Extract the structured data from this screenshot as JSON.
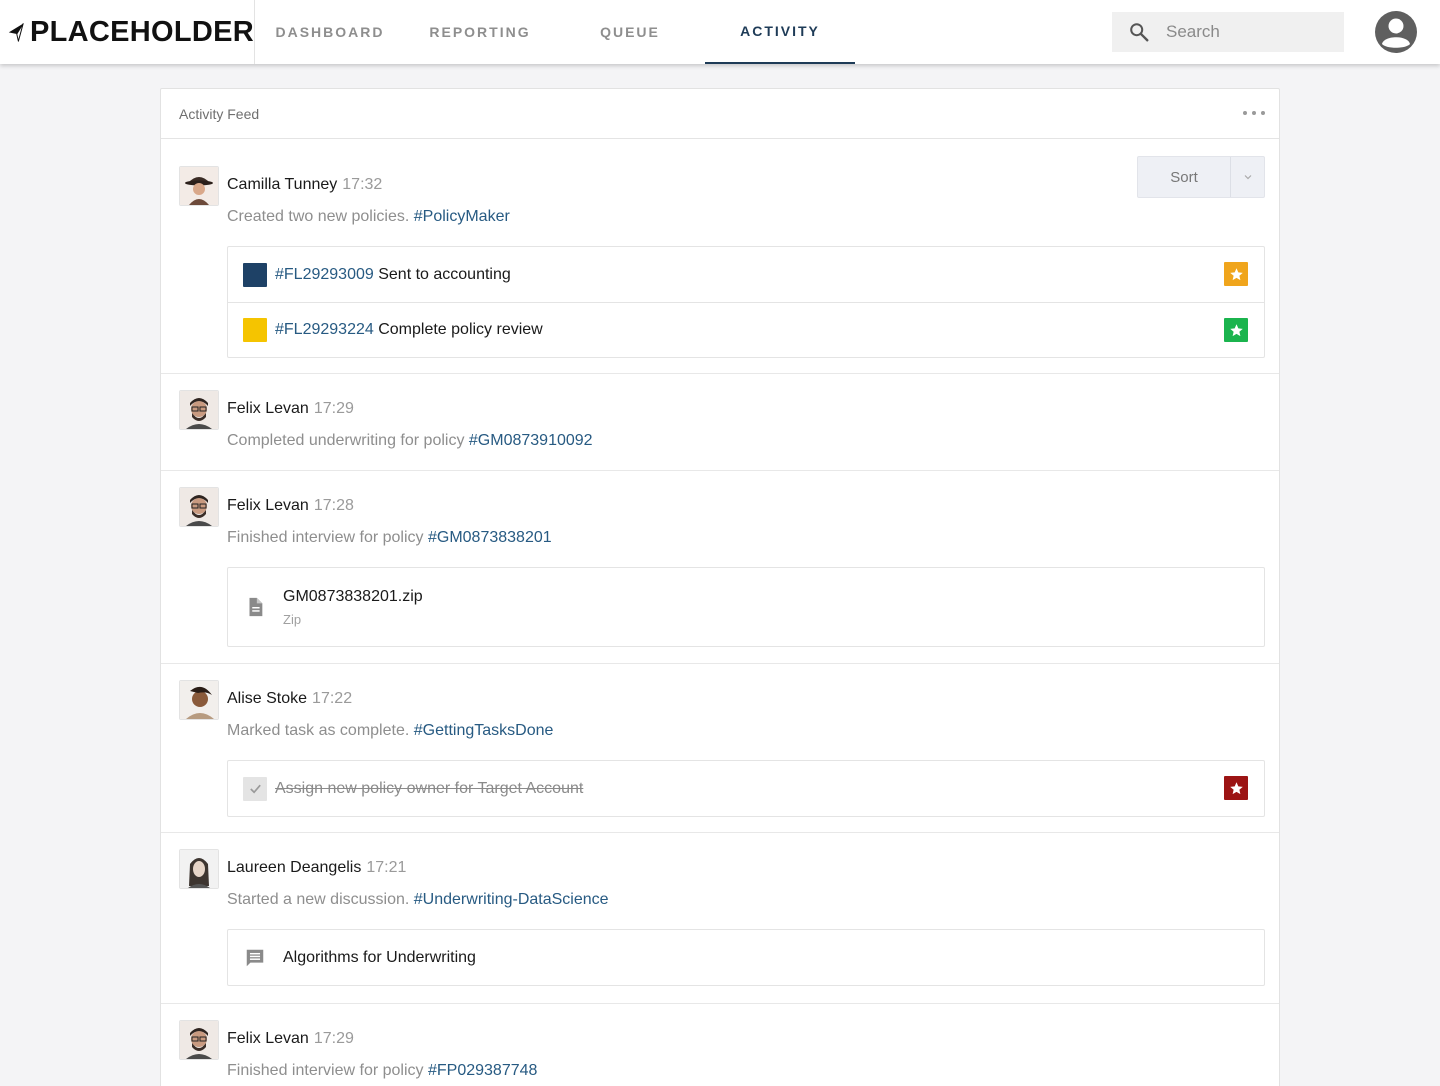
{
  "header": {
    "logo_text": "PLACEHOLDER",
    "tabs": [
      {
        "label": "DASHBOARD"
      },
      {
        "label": "REPORTING"
      },
      {
        "label": "QUEUE"
      },
      {
        "label": "ACTIVITY",
        "active": true
      }
    ],
    "search_placeholder": "Search"
  },
  "feed": {
    "title": "Activity Feed",
    "sort_label": "Sort",
    "entries": [
      {
        "name": "Camilla Tunney",
        "time": "17:32",
        "text": "Created two new policies.",
        "tag": "#PolicyMaker",
        "items": [
          {
            "id": "#FL29293009",
            "label": "Sent to accounting",
            "swatch": "#1e4166",
            "star_color": "#f0a51c"
          },
          {
            "id": "#FL29293224",
            "label": "Complete policy review",
            "swatch": "#f5c400",
            "star_color": "#1bb44e"
          }
        ]
      },
      {
        "name": "Felix Levan",
        "time": "17:29",
        "text": "Completed underwriting for policy",
        "tag": "#GM0873910092"
      },
      {
        "name": "Felix Levan",
        "time": "17:28",
        "text": "Finished interview for policy",
        "tag": "#GM0873838201",
        "file": {
          "name": "GM0873838201.zip",
          "type": "Zip",
          "icon": "document-icon"
        }
      },
      {
        "name": "Alise Stoke",
        "time": "17:22",
        "text": "Marked task as complete.",
        "tag": "#GettingTasksDone",
        "task": {
          "label": "Assign new policy owner for Target Account",
          "star_color": "#9c1414"
        }
      },
      {
        "name": "Laureen Deangelis",
        "time": "17:21",
        "text": "Started a new discussion.",
        "tag": "#Underwriting-DataScience",
        "discussion": {
          "label": "Algorithms for Underwriting",
          "icon": "comment-icon"
        }
      },
      {
        "name": "Felix Levan",
        "time": "17:29",
        "text": "Finished interview for policy",
        "tag": "#FP029387748"
      }
    ]
  },
  "colors": {
    "accent": "#1e3b57",
    "link": "#275a82"
  }
}
